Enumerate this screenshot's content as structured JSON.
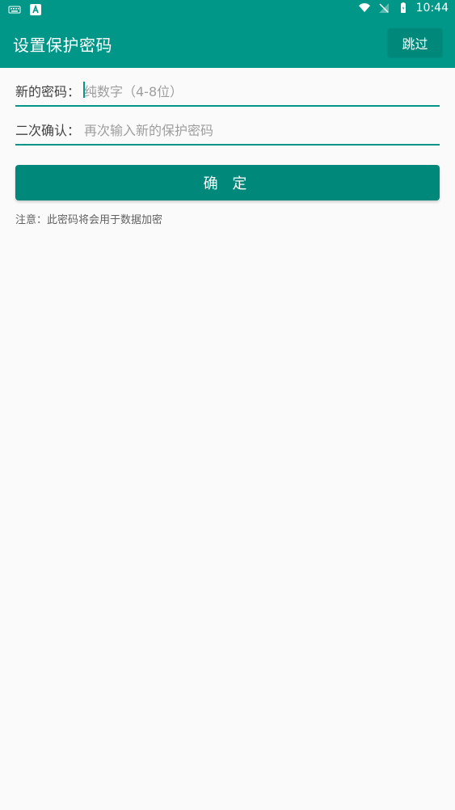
{
  "status": {
    "time": "10:44",
    "icons": [
      "keyboard-icon",
      "a-icon",
      "wifi-icon",
      "signal-icon",
      "battery-icon"
    ]
  },
  "appbar": {
    "title": "设置保护密码",
    "skip_label": "跳过"
  },
  "form": {
    "new_password": {
      "label": "新的密码：",
      "placeholder": "纯数字（4-8位）"
    },
    "confirm_password": {
      "label": "二次确认：",
      "placeholder": "再次输入新的保护密码"
    }
  },
  "actions": {
    "confirm_label": "确 定"
  },
  "footer": {
    "note": "注意：此密码将会用于数据加密"
  },
  "colors": {
    "primary": "#009688",
    "primary_dark": "#00897b",
    "background": "#fafafa",
    "text_secondary": "#9e9e9e"
  }
}
